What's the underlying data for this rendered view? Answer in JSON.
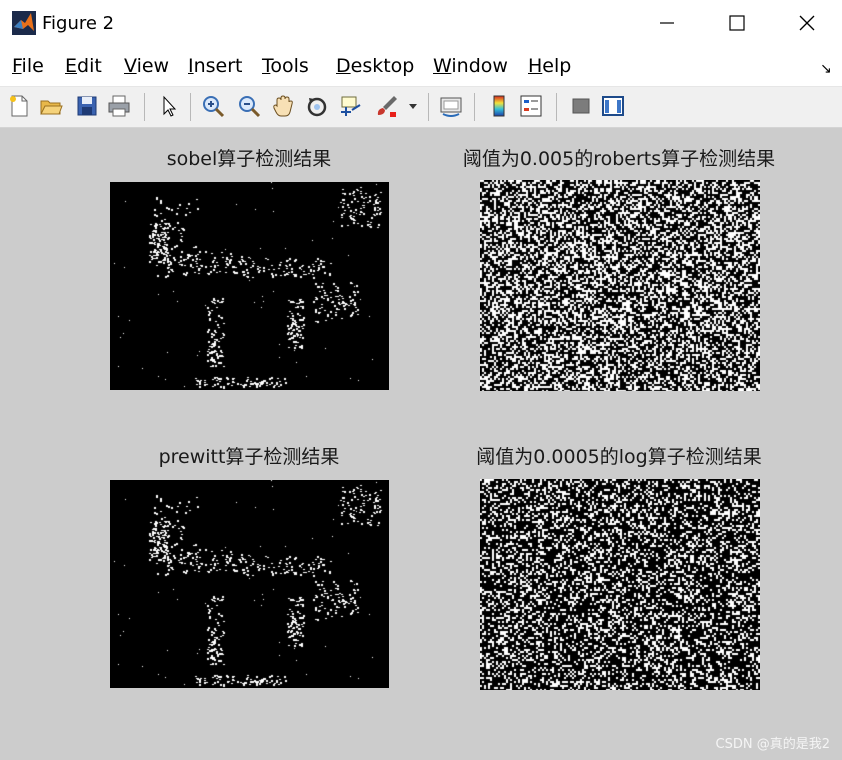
{
  "window": {
    "title": "Figure 2",
    "controls": [
      "minimize",
      "maximize",
      "close"
    ]
  },
  "menu": [
    {
      "label": "File",
      "accel": "F"
    },
    {
      "label": "Edit",
      "accel": "E"
    },
    {
      "label": "View",
      "accel": "V"
    },
    {
      "label": "Insert",
      "accel": "I"
    },
    {
      "label": "Tools",
      "accel": "T"
    },
    {
      "label": "Desktop",
      "accel": "D"
    },
    {
      "label": "Window",
      "accel": "W"
    },
    {
      "label": "Help",
      "accel": "H"
    }
  ],
  "toolbar": [
    "new-figure-icon",
    "open-file-icon",
    "save-icon",
    "print-icon",
    "pointer-icon",
    "zoom-in-icon",
    "zoom-out-icon",
    "pan-icon",
    "rotate-3d-icon",
    "data-cursor-icon",
    "brush-icon",
    "link-plot-icon",
    "colorbar-icon",
    "legend-icon",
    "hide-plot-tools-icon",
    "show-plot-tools-icon"
  ],
  "subplots": [
    {
      "title": "sobel算子检测结果",
      "density": "sparse"
    },
    {
      "title": "阈值为0.005的roberts算子检测结果",
      "density": "dense"
    },
    {
      "title": "prewitt算子检测结果",
      "density": "sparse"
    },
    {
      "title": "阈值为0.0005的log算子检测结果",
      "density": "dense"
    }
  ],
  "watermark": "CSDN @真的是我2",
  "colors": {
    "canvas_bg": "#cccccc",
    "plot_bg": "#000000",
    "edge_pixels": "#ffffff"
  }
}
